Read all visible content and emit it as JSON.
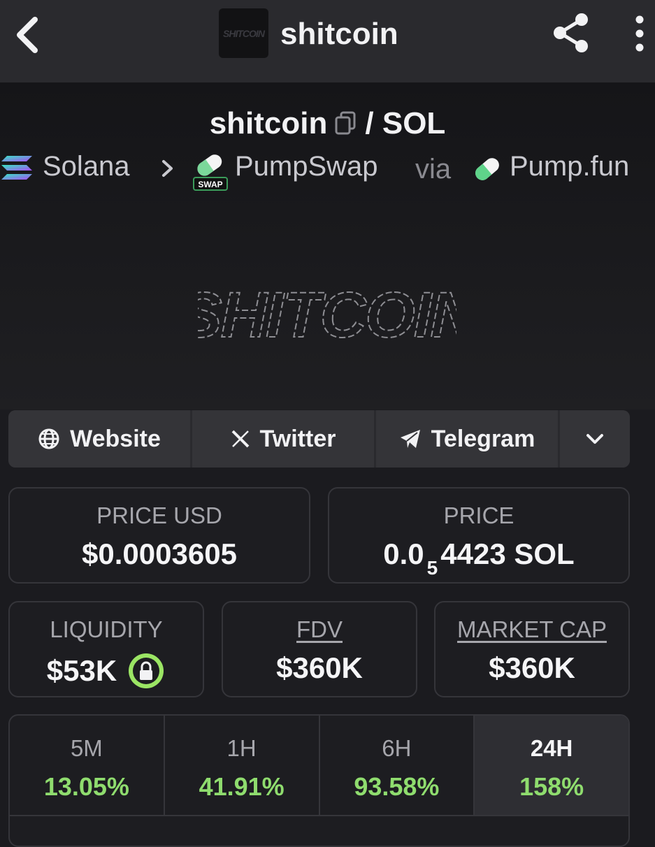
{
  "topbar": {
    "title": "shitcoin",
    "logo_text": "SHITCOIN",
    "icons": {
      "back": "chevron-left-icon",
      "share": "share-icon",
      "more": "more-vertical-icon"
    }
  },
  "pair": {
    "base": "shitcoin",
    "separator": "/",
    "quote": "SOL"
  },
  "chain_path": {
    "chain": "Solana",
    "dex": "PumpSwap",
    "dex_badge": "SWAP",
    "via_label": "via",
    "launchpad": "Pump.fun"
  },
  "banner": {
    "text": "SHITCOIN"
  },
  "socials": [
    {
      "label": "Website",
      "icon": "globe-icon"
    },
    {
      "label": "Twitter",
      "icon": "x-icon"
    },
    {
      "label": "Telegram",
      "icon": "telegram-icon"
    }
  ],
  "stats": {
    "price_usd": {
      "label": "PRICE USD",
      "value": "$0.0003605"
    },
    "price": {
      "label": "PRICE",
      "value_prefix": "0.0",
      "value_subscript": "5",
      "value_suffix": "4423 SOL"
    },
    "liquidity": {
      "label": "LIQUIDITY",
      "value": "$53K"
    },
    "fdv": {
      "label": "FDV",
      "value": "$360K"
    },
    "market_cap": {
      "label": "MARKET CAP",
      "value": "$360K"
    }
  },
  "timeframes": [
    {
      "label": "5M",
      "change": "13.05%"
    },
    {
      "label": "1H",
      "change": "41.91%"
    },
    {
      "label": "6H",
      "change": "93.58%"
    },
    {
      "label": "24H",
      "change": "158%",
      "active": true
    }
  ],
  "colors": {
    "accent_green": "#8fdc6e",
    "lock_green": "#9be564",
    "background": "#1b1b1f"
  }
}
